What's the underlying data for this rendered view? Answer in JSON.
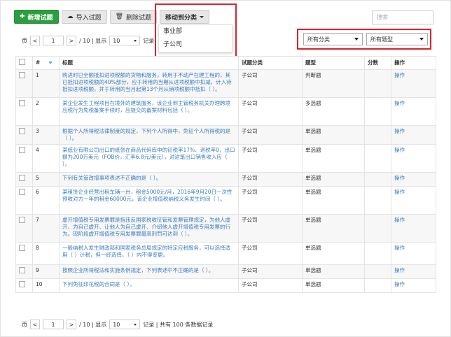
{
  "toolbar": {
    "new_label": "新增试题",
    "import_label": "导入试题",
    "delete_label": "删除试题",
    "move_label": "移动到分类"
  },
  "move_menu": [
    "事业部",
    "子公司"
  ],
  "search": {
    "placeholder": "搜索"
  },
  "pager": {
    "page_label": "页",
    "prev": "<",
    "current_page": "1",
    "next": ">",
    "total_text": "/ 10 | 显示",
    "page_size": "10",
    "record_label_top": "记录",
    "record_label_bottom": "记录 | 共有 100 条数据记录"
  },
  "filters": {
    "category": "所有分类",
    "type": "所有题型"
  },
  "table": {
    "headers": {
      "num": "#",
      "title": "标题",
      "category": "试题分类",
      "type": "题型",
      "score": "分数",
      "op": "操作"
    },
    "rows": [
      {
        "num": "1",
        "title": "购进时已全额抵扣进项税额的货物和服务，转用于不动产在建工程的，其已抵扣进项税额的40%部分，应于转用的当期从进项税额中扣减，计入待抵扣进项税额，并于转用的当月起第13个月从销项税额中抵扣（ ）。",
        "category": "子公司",
        "type": "判断题",
        "score": "",
        "op": "操作"
      },
      {
        "num": "2",
        "title": "某企业发生工程项目在境外的建筑服务，该企业到主管税务机关办理跨境应税行为免税备案手续时，应提交的备案材料包括（ ）。",
        "category": "子公司",
        "type": "多选题",
        "score": "",
        "op": "操作"
      },
      {
        "num": "3",
        "title": "根据个人所得税法律制度的规定，下列个人所得中，免征个人所得税的是（ ）。",
        "category": "子公司",
        "type": "单选题",
        "score": "",
        "op": "操作"
      },
      {
        "num": "4",
        "title": "某纸业有限公司出口的纸张在商品代码库中的征税率17%、退税率0，出口额为200万美元（FOB价，汇率6.8元/美元），对这笔出口销售收入应（ ）。",
        "category": "子公司",
        "type": "单选题",
        "score": "",
        "op": "操作"
      },
      {
        "num": "5",
        "title": "下列有关管改增事项表述不正确的是（ ）。",
        "category": "子公司",
        "type": "单选题",
        "score": "",
        "op": "操作"
      },
      {
        "num": "6",
        "title": "某租赁企业经营出租车辆一台，租金5000元/月，2016年9月20日一次性预收对方一年的租金60000元，该企业增值税纳税义务发生时间（ ）。",
        "category": "子公司",
        "type": "单选题",
        "score": "",
        "op": "操作"
      },
      {
        "num": "7",
        "title": "虚开增值税专用发票罪是指违反国家税收征管和发票管理规定，为他人虚开、为自己虚开、让他人为自己虚开、介绍他人虚开增值税专用发票的行为。现阶段虚开增值税专用发票罪最高刑罚可达到（ ）。",
        "category": "子公司",
        "type": "单选题",
        "score": "",
        "op": "操作"
      },
      {
        "num": "8",
        "title": "一般纳税人发生财政部和国家税务总局规定的特定应税服务，可以选择适用（ ）计税，但一经选择，（ ）内不得变更。",
        "category": "子公司",
        "type": "单选题",
        "score": "",
        "op": "操作"
      },
      {
        "num": "9",
        "title": "按照企业所得税法和实施条例规定，下列表述中不正确的是（ ）。",
        "category": "子公司",
        "type": "单选题",
        "score": "",
        "op": "操作"
      },
      {
        "num": "10",
        "title": "下列免征印花税的合同是（ ）。",
        "category": "子公司",
        "type": "单选题",
        "score": "",
        "op": "操作"
      }
    ]
  }
}
